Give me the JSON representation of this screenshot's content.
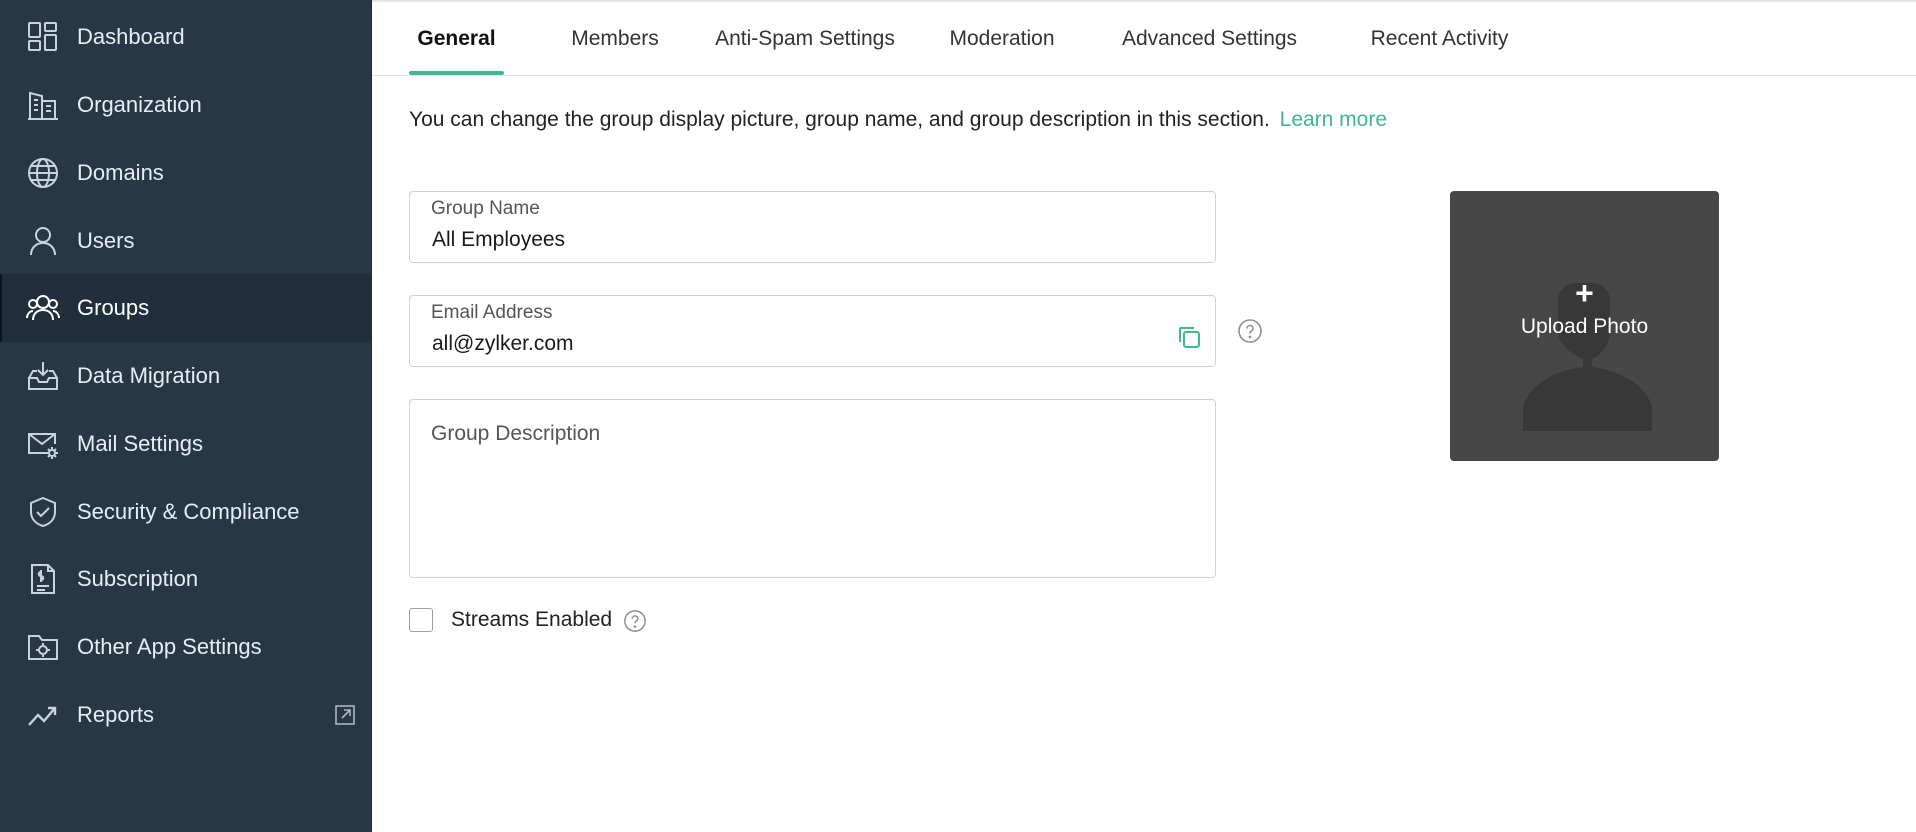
{
  "sidebar": {
    "items": [
      {
        "label": "Dashboard",
        "icon": "dashboard-icon"
      },
      {
        "label": "Organization",
        "icon": "building-icon"
      },
      {
        "label": "Domains",
        "icon": "globe-icon"
      },
      {
        "label": "Users",
        "icon": "user-icon"
      },
      {
        "label": "Groups",
        "icon": "groups-icon",
        "active": true
      },
      {
        "label": "Data Migration",
        "icon": "inbox-download-icon"
      },
      {
        "label": "Mail Settings",
        "icon": "mail-gear-icon"
      },
      {
        "label": "Security & Compliance",
        "icon": "shield-check-icon"
      },
      {
        "label": "Subscription",
        "icon": "invoice-icon"
      },
      {
        "label": "Other App Settings",
        "icon": "folder-gear-icon"
      },
      {
        "label": "Reports",
        "icon": "trend-icon",
        "external": "external-link-icon"
      }
    ]
  },
  "tabs": [
    {
      "label": "General",
      "active": true
    },
    {
      "label": "Members"
    },
    {
      "label": "Anti-Spam Settings"
    },
    {
      "label": "Moderation"
    },
    {
      "label": "Advanced Settings"
    },
    {
      "label": "Recent Activity"
    }
  ],
  "general": {
    "description": "You can change the group display picture, group name, and group description in this section.",
    "learn_more": "Learn more",
    "group_name": {
      "label": "Group Name",
      "value": "All Employees"
    },
    "email": {
      "label": "Email Address",
      "value": "all@zylker.com"
    },
    "group_description": {
      "placeholder": "Group Description",
      "value": ""
    },
    "upload_photo": {
      "plus": "+",
      "label": "Upload Photo"
    },
    "streams": {
      "label": "Streams Enabled",
      "checked": false
    }
  },
  "colors": {
    "sidebar_bg": "#283746",
    "sidebar_active_bg": "#212f3c",
    "accent": "#3fb98a",
    "photo_bg": "#474747"
  }
}
